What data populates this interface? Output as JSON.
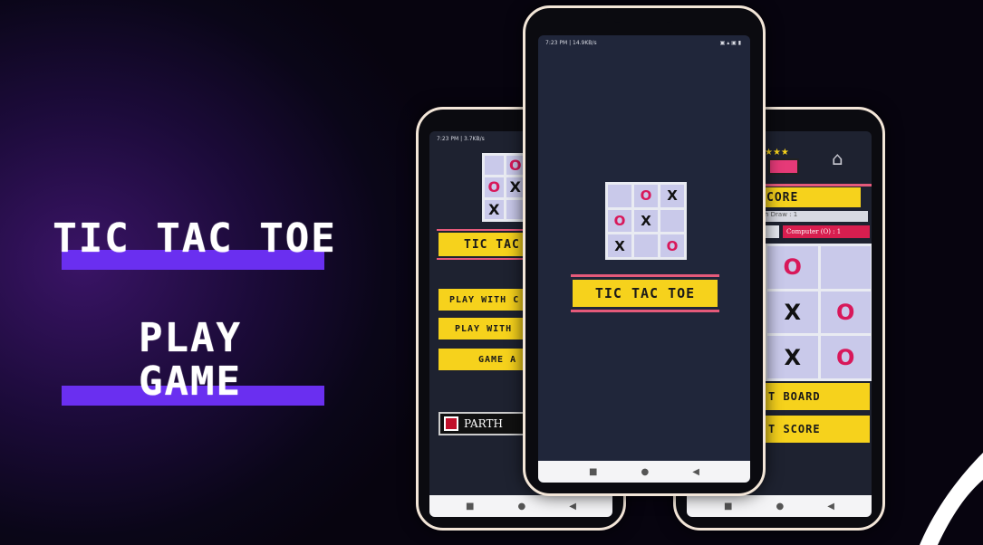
{
  "headline": {
    "title": "TIC TAC TOE",
    "subtitle_line1": "PLAY",
    "subtitle_line2": "GAME"
  },
  "colors": {
    "accent_bar": "#6a2ff0",
    "button_yellow": "#f6d21c",
    "o_mark": "#d8185a",
    "screen_bg": "#1e2230"
  },
  "phone_left": {
    "status": "7:23 PM | 3.7KB/s",
    "logo_board": [
      "",
      "O",
      "",
      "O",
      "X",
      "",
      "X",
      "",
      ""
    ],
    "title": "TIC TAC",
    "buttons": [
      "PLAY WITH C",
      "PLAY WITH",
      "GAME A"
    ],
    "brand": "PARTH"
  },
  "phone_center": {
    "status": "7:23 PM | 14.9KB/s",
    "logo_board": [
      "",
      "O",
      "X",
      "O",
      "X",
      "",
      "X",
      "",
      "O"
    ],
    "title": "TIC TAC TOE"
  },
  "phone_right": {
    "score_title": "CORE",
    "draw_label": "h Draw : 1",
    "computer_label": "Computer (O) : 1",
    "board": [
      "O",
      "",
      "X",
      "O",
      "X",
      "O"
    ],
    "buttons": [
      "T BOARD",
      "T SCORE"
    ],
    "home_icon": "home-icon",
    "stars_icon": "stars-icon"
  }
}
